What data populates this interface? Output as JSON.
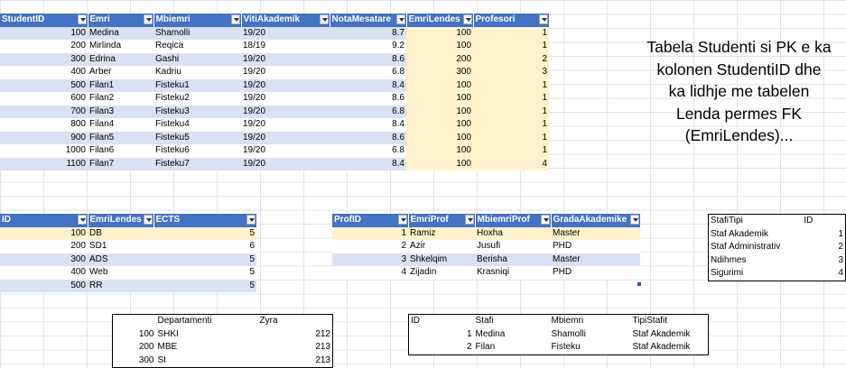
{
  "studenti": {
    "headers": [
      "StudentID",
      "Emri",
      "Mbiemri",
      "VitiAkademik",
      "NotaMesatare",
      "EmriLendes",
      "Profesori"
    ],
    "rows": [
      [
        "100",
        "Medina",
        "Shamolli",
        "19/20",
        "8.7",
        "100",
        "1"
      ],
      [
        "200",
        "Mirlinda",
        "Reqica",
        "18/19",
        "9.2",
        "100",
        "1"
      ],
      [
        "300",
        "Edrina",
        "Gashi",
        "19/20",
        "8.6",
        "200",
        "2"
      ],
      [
        "400",
        "Arber",
        "Kadriu",
        "19/20",
        "6.8",
        "300",
        "3"
      ],
      [
        "500",
        "Filan1",
        "Fisteku1",
        "19/20",
        "8.4",
        "100",
        "1"
      ],
      [
        "600",
        "Filan2",
        "Fisteku2",
        "19/20",
        "8.6",
        "100",
        "1"
      ],
      [
        "700",
        "Filan3",
        "Fisteku3",
        "19/20",
        "6.8",
        "100",
        "1"
      ],
      [
        "800",
        "Filan4",
        "Fisteku4",
        "19/20",
        "8.4",
        "100",
        "1"
      ],
      [
        "900",
        "Filan5",
        "Fisteku5",
        "19/20",
        "8.6",
        "100",
        "1"
      ],
      [
        "1000",
        "Filan6",
        "Fisteku6",
        "19/20",
        "6.8",
        "100",
        "1"
      ],
      [
        "1100",
        "Filan7",
        "Fisteku7",
        "19/20",
        "8.4",
        "100",
        "4"
      ]
    ]
  },
  "note": {
    "lines": [
      "Tabela Studenti si PK e ka",
      "kolonen StudentiID dhe",
      "ka lidhje me tabelen",
      "Lenda permes FK",
      "(EmriLendes)..."
    ]
  },
  "lenda": {
    "headers": [
      "ID",
      "EmriLendes",
      "ECTS"
    ],
    "rows": [
      [
        "100",
        "DB",
        "5"
      ],
      [
        "200",
        "SD1",
        "6"
      ],
      [
        "300",
        "ADS",
        "5"
      ],
      [
        "400",
        "Web",
        "5"
      ],
      [
        "500",
        "RR",
        "5"
      ]
    ]
  },
  "profesori": {
    "headers": [
      "ProfID",
      "EmriProf",
      "MbiemriProf",
      "GradaAkademike"
    ],
    "rows": [
      [
        "1",
        "Ramiz",
        "Hoxha",
        "Master"
      ],
      [
        "2",
        "Azir",
        "Jusufi",
        "PHD"
      ],
      [
        "3",
        "Shkelqim",
        "Berisha",
        "Master"
      ],
      [
        "4",
        "Zijadin",
        "Krasniqi",
        "PHD"
      ]
    ]
  },
  "stafi_tipi": {
    "headers": [
      "StafiTipi",
      "ID"
    ],
    "rows": [
      [
        "Staf Akademik",
        "1"
      ],
      [
        "Staf Administrativ",
        "2"
      ],
      [
        "Ndihmes",
        "3"
      ],
      [
        "Sigurimi",
        "4"
      ]
    ]
  },
  "departamenti": {
    "headers": [
      "Departamenti",
      "Zyra"
    ],
    "rows": [
      [
        "100",
        "SHKI",
        "212"
      ],
      [
        "200",
        "MBE",
        "213"
      ],
      [
        "300",
        "SI",
        "213"
      ]
    ]
  },
  "stafi": {
    "headers": [
      "ID",
      "Stafi",
      "Mbiemri",
      "TipiStafit"
    ],
    "rows": [
      [
        "1",
        "Medina",
        "Shamolli",
        "Staf Akademik"
      ],
      [
        "2",
        "Filan",
        "Fisteku",
        "Staf Akademik"
      ]
    ]
  },
  "colors": {
    "header": "#4472c4",
    "band": "#d9e1f2",
    "highlight": "#fff2cc"
  }
}
